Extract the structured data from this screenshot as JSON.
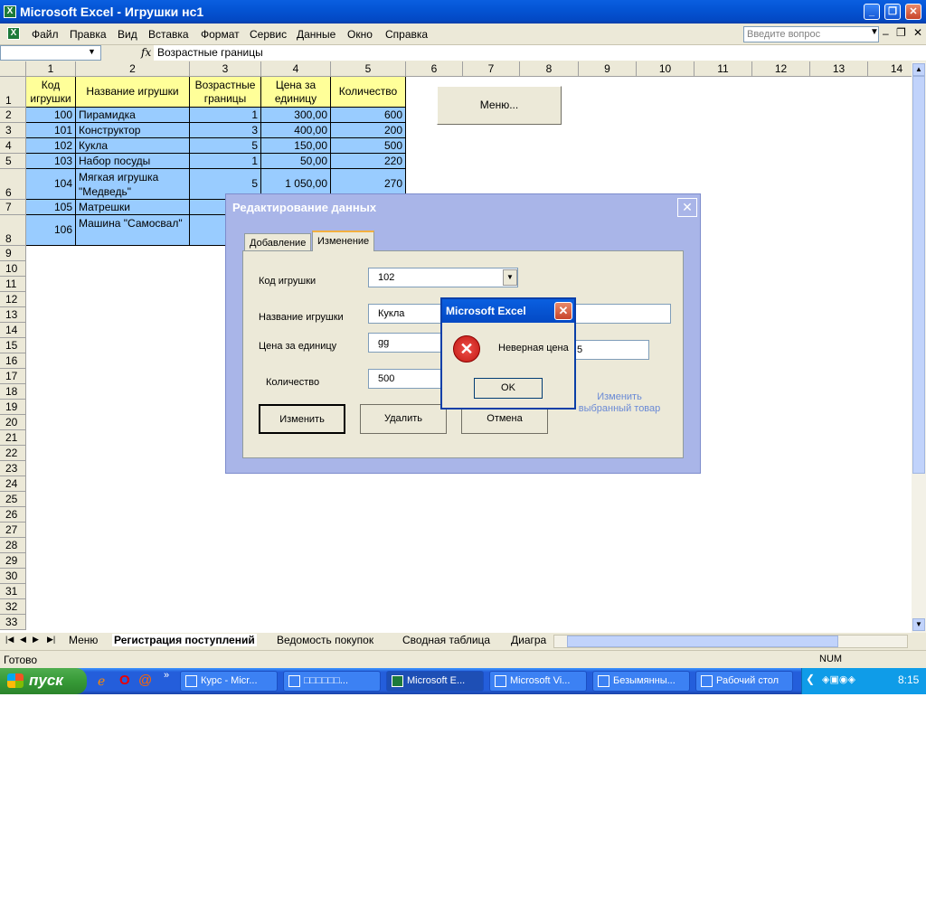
{
  "window": {
    "title": "Microsoft Excel - Игрушки нс1"
  },
  "menu": [
    "Файл",
    "Правка",
    "Вид",
    "Вставка",
    "Формат",
    "Сервис",
    "Данные",
    "Окно",
    "Справка"
  ],
  "ask_placeholder": "Введите вопрос",
  "formula": {
    "name_box": "",
    "fx": "fx",
    "content": "Возрастные границы"
  },
  "columns": [
    "1",
    "2",
    "3",
    "4",
    "5",
    "6",
    "7",
    "8",
    "9",
    "10",
    "11",
    "12",
    "13",
    "14"
  ],
  "rows": [
    "1",
    "2",
    "3",
    "4",
    "5",
    "6",
    "7",
    "8",
    "9",
    "10",
    "11",
    "12",
    "13",
    "14",
    "15",
    "16",
    "17",
    "18",
    "19",
    "20",
    "21",
    "22",
    "23",
    "24",
    "25",
    "26",
    "27",
    "28",
    "29",
    "30",
    "31",
    "32",
    "33"
  ],
  "table": {
    "headers": [
      "Код игрушки",
      "Название игрушки",
      "Возрастные границы",
      "Цена за единицу",
      "Количество"
    ],
    "rows": [
      [
        "100",
        "Пирамидка",
        "1",
        "300,00",
        "600"
      ],
      [
        "101",
        "Конструктор",
        "3",
        "400,00",
        "200"
      ],
      [
        "102",
        "Кукла",
        "5",
        "150,00",
        "500"
      ],
      [
        "103",
        "Набор посуды",
        "1",
        "50,00",
        "220"
      ],
      [
        "104",
        "Мягкая игрушка \"Медведь\"",
        "5",
        "1 050,00",
        "270"
      ],
      [
        "105",
        "Матрешки",
        "",
        "",
        ""
      ],
      [
        "106",
        "Машина \"Самосвал\"",
        "",
        "",
        ""
      ]
    ]
  },
  "sheet_button": "Меню...",
  "dialog": {
    "title": "Редактирование данных",
    "tabs": [
      "Добавление",
      "Изменение"
    ],
    "labels": {
      "code": "Код игрушки",
      "name": "Название игрушки",
      "price": "Цена за единицу",
      "qty": "Количество"
    },
    "values": {
      "code": "102",
      "name": "Кукла",
      "price": "gg",
      "qty": "500",
      "partial": "5"
    },
    "hint": "Изменить выбранный товар",
    "buttons": {
      "change": "Изменить",
      "delete": "Удалить",
      "cancel": "Отмена"
    }
  },
  "msgbox": {
    "title": "Microsoft Excel",
    "text": "Неверная цена",
    "ok": "OK"
  },
  "sheet_tabs": [
    "Меню",
    "Регистрация поступлений",
    "Ведомость покупок",
    "Сводная таблица",
    "Диагра"
  ],
  "status": {
    "left": "Готово",
    "num": "NUM"
  },
  "taskbar": {
    "start": "пуск",
    "items": [
      "Курс - Micr...",
      "□□□□□□...",
      "Microsoft E...",
      "Microsoft Vi...",
      "Безымянны...",
      "Рабочий стол"
    ],
    "clock": "8:15"
  },
  "colors": {
    "header_yellow": "#ffff99",
    "data_blue": "#99ccff",
    "xp_blue": "#245edb",
    "dialog_frame": "#a9b5e8"
  }
}
